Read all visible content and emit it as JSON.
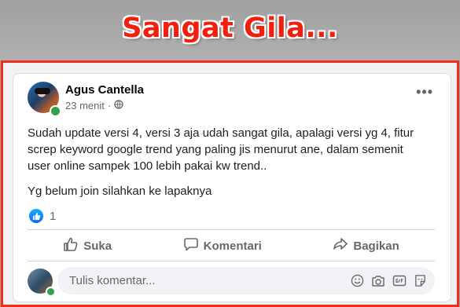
{
  "banner": {
    "headline": "Sangat Gila..."
  },
  "post": {
    "author": "Agus Cantella",
    "time": "23 menit",
    "separator": "·",
    "paragraphs": [
      "Sudah update versi 4, versi 3 aja udah sangat gila, apalagi versi yg 4, fitur screp keyword google trend yang paling jis menurut ane, dalam semenit user online sampek 100 lebih pakai kw trend..",
      "Yg belum join silahkan ke lapaknya"
    ],
    "reaction_count": "1"
  },
  "actions": {
    "like": "Suka",
    "comment": "Komentari",
    "share": "Bagikan"
  },
  "comment": {
    "placeholder": "Tulis komentar..."
  },
  "colors": {
    "accent_red": "#f31f0e",
    "like_blue": "#0866ff",
    "online_green": "#31a24c"
  },
  "icons": [
    "globe-icon",
    "more-icon",
    "like-icon",
    "comment-icon",
    "share-icon",
    "emoji-icon",
    "camera-icon",
    "gif-icon",
    "sticker-icon"
  ]
}
